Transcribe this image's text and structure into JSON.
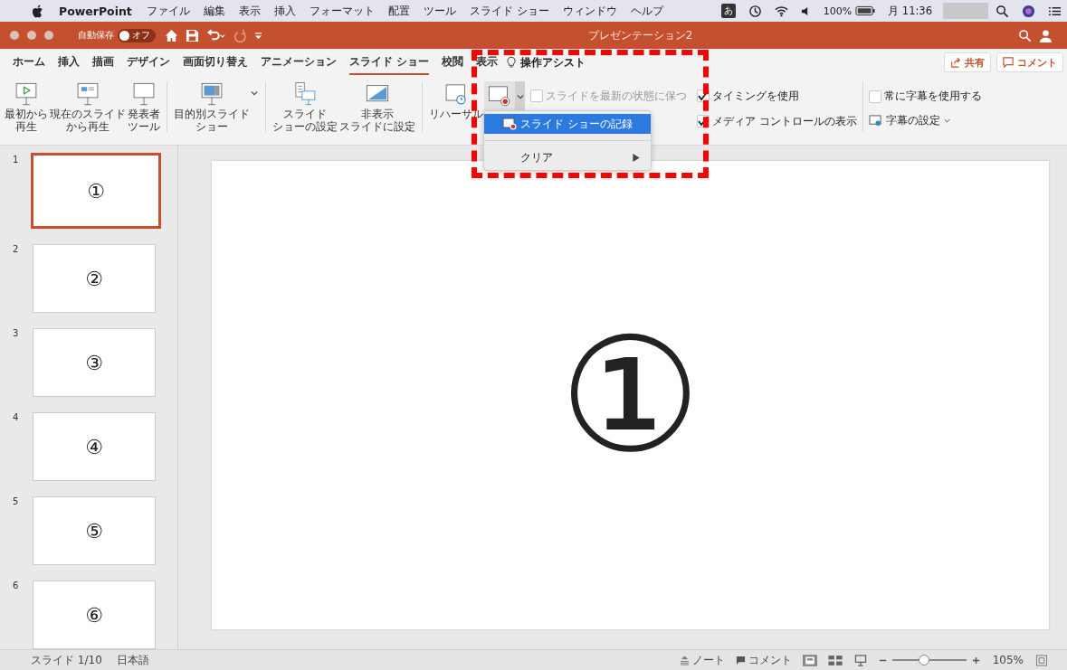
{
  "menubar": {
    "app": "PowerPoint",
    "items": [
      "ファイル",
      "編集",
      "表示",
      "挿入",
      "フォーマット",
      "配置",
      "ツール",
      "スライド ショー",
      "ウィンドウ",
      "ヘルプ"
    ],
    "input_method": "あ",
    "battery": "100%",
    "clock": "月 11:36"
  },
  "titlebar": {
    "autosave_label": "自動保存",
    "autosave_toggle": "オフ",
    "autosave_on": false,
    "title": "プレゼンテーション2"
  },
  "tabs": [
    {
      "label": "ホーム",
      "selected": false
    },
    {
      "label": "挿入",
      "selected": false
    },
    {
      "label": "描画",
      "selected": false
    },
    {
      "label": "デザイン",
      "selected": false
    },
    {
      "label": "画面切り替え",
      "selected": false
    },
    {
      "label": "アニメーション",
      "selected": false
    },
    {
      "label": "スライド ショー",
      "selected": true
    },
    {
      "label": "校閲",
      "selected": false
    },
    {
      "label": "表示",
      "selected": false
    }
  ],
  "assist": "操作アシスト",
  "share_button": "共有",
  "comment_button": "コメント",
  "ribbon": {
    "buttons": [
      {
        "kind": "play",
        "lines": [
          "最初から",
          "再生"
        ]
      },
      {
        "kind": "current",
        "lines": [
          "現在のスライド",
          "から再生"
        ]
      },
      {
        "kind": "presenter",
        "lines": [
          "発表者",
          "ツール"
        ]
      },
      {
        "kind": "custom",
        "lines": [
          "目的別スライド",
          "ショー"
        ]
      },
      {
        "kind": "setup",
        "lines": [
          "スライド",
          "ショーの設定"
        ]
      },
      {
        "kind": "hide",
        "lines": [
          "非表示",
          "スライドに設定"
        ]
      },
      {
        "kind": "rehearse",
        "lines": [
          "リハーサル"
        ]
      },
      {
        "kind": "record"
      }
    ],
    "options": [
      {
        "label": "スライドを最新の状態に保つ",
        "checked": false,
        "disabled": true
      },
      {
        "label": "タイミングを使用",
        "checked": true,
        "disabled": false
      },
      {
        "label": "メディア コントロールの表示",
        "checked": true,
        "disabled": false
      }
    ],
    "captions": {
      "label": "常に字幕を使用する",
      "checked": false
    },
    "caption_settings": "字幕の設定"
  },
  "dropdown": {
    "items": [
      {
        "label": "スライド ショーの記録",
        "selected": true,
        "submenu": false
      },
      {
        "label": "クリア",
        "selected": false,
        "submenu": true
      }
    ]
  },
  "slides": [
    {
      "number": "1",
      "content": "①",
      "selected": true
    },
    {
      "number": "2",
      "content": "②",
      "selected": false
    },
    {
      "number": "3",
      "content": "③",
      "selected": false
    },
    {
      "number": "4",
      "content": "④",
      "selected": false
    },
    {
      "number": "5",
      "content": "⑤",
      "selected": false
    },
    {
      "number": "6",
      "content": "⑥",
      "selected": false
    }
  ],
  "main_slide": {
    "content": "①"
  },
  "status_bar": {
    "slide": "スライド 1/10",
    "language": "日本語",
    "notes": "ノート",
    "comments": "コメント",
    "zoom_slider": {
      "level": 0.42
    },
    "zoom": "105%"
  }
}
